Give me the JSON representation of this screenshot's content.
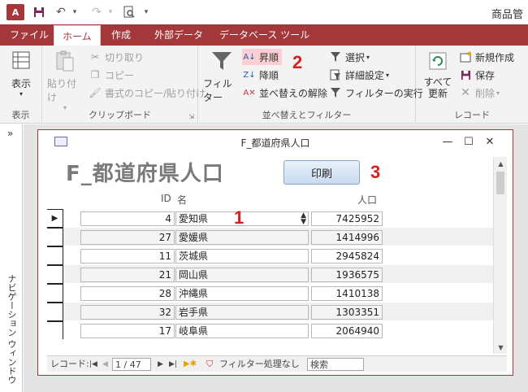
{
  "app": {
    "logo": "A",
    "title": "商品管"
  },
  "tabs": [
    {
      "label": "ファイル"
    },
    {
      "label": "ホーム"
    },
    {
      "label": "作成"
    },
    {
      "label": "外部データ"
    },
    {
      "label": "データベース ツール"
    }
  ],
  "ribbon": {
    "view": {
      "label": "表示",
      "group": "表示"
    },
    "clipboard": {
      "paste": "貼り付け",
      "cut": "切り取り",
      "copy": "コピー",
      "format_painter": "書式のコピー/貼り付け",
      "group": "クリップボード"
    },
    "sort_filter": {
      "filter": "フィルター",
      "ascending": "昇順",
      "descending": "降順",
      "clear_sort": "並べ替えの解除",
      "selection": "選択",
      "advanced": "詳細設定",
      "toggle_filter": "フィルターの実行",
      "group": "並べ替えとフィルター"
    },
    "records": {
      "refresh_all": "すべて更新",
      "new": "新規作成",
      "save": "保存",
      "delete": "削除",
      "group": "レコード"
    }
  },
  "annotations": [
    "1",
    "2",
    "3"
  ],
  "navpane": {
    "label": "ナビゲーション ウィンドウ"
  },
  "form_window": {
    "title": "F_都道府県人口",
    "heading": "F_都道府県人口",
    "print_button": "印刷",
    "columns": {
      "id": "ID",
      "name": "名",
      "population": "人口"
    },
    "rows": [
      {
        "id": "4",
        "name": "愛知県",
        "population": "7425952"
      },
      {
        "id": "27",
        "name": "愛媛県",
        "population": "1414996"
      },
      {
        "id": "11",
        "name": "茨城県",
        "population": "2945824"
      },
      {
        "id": "21",
        "name": "岡山県",
        "population": "1936575"
      },
      {
        "id": "28",
        "name": "沖縄県",
        "population": "1410138"
      },
      {
        "id": "32",
        "name": "岩手県",
        "population": "1303351"
      },
      {
        "id": "17",
        "name": "岐阜県",
        "population": "2064940"
      }
    ]
  },
  "record_bar": {
    "label": "レコード:",
    "position": "1 / 47",
    "filter_status": "フィルター処理なし",
    "search": "検索"
  }
}
